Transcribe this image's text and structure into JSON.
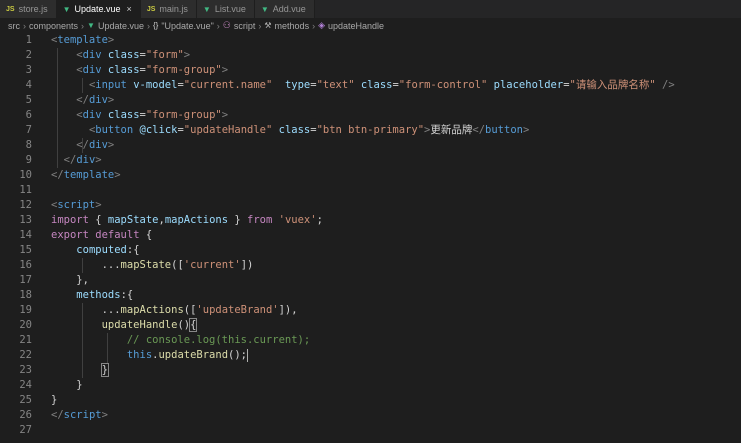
{
  "tabs": [
    {
      "label": "store.js",
      "type": "js",
      "active": false
    },
    {
      "label": "Update.vue",
      "type": "vue",
      "active": true
    },
    {
      "label": "main.js",
      "type": "js",
      "active": false
    },
    {
      "label": "List.vue",
      "type": "vue",
      "active": false
    },
    {
      "label": "Add.vue",
      "type": "vue",
      "active": false
    }
  ],
  "breadcrumb": [
    {
      "label": "src",
      "icon": "none"
    },
    {
      "label": "components",
      "icon": "none"
    },
    {
      "label": "Update.vue",
      "icon": "vue-file-icon"
    },
    {
      "label": "\"Update.vue\"",
      "icon": "object-icon"
    },
    {
      "label": "script",
      "icon": "symbol-icon"
    },
    {
      "label": "methods",
      "icon": "wrench-icon"
    },
    {
      "label": "updateHandle",
      "icon": "method-cube-icon"
    }
  ],
  "colors": {
    "editor_bg": "#1e1e1e",
    "tab_bar_bg": "#252526",
    "tag": "#569cd6",
    "attribute": "#9cdcfe",
    "string": "#ce9178",
    "keyword": "#c586c0",
    "function": "#dcdcaa",
    "comment": "#6a9955"
  },
  "lines": [
    {
      "n": "1",
      "tokens": [
        [
          "<",
          "t-bracket"
        ],
        [
          "template",
          "t-tag"
        ],
        [
          ">",
          "t-bracket"
        ]
      ]
    },
    {
      "n": "2",
      "tokens": [
        [
          "    ",
          "t-text"
        ],
        [
          "<",
          "t-bracket"
        ],
        [
          "div",
          "t-tag"
        ],
        [
          " ",
          "t-text"
        ],
        [
          "class",
          "t-attr"
        ],
        [
          "=",
          "t-text"
        ],
        [
          "\"form\"",
          "t-str"
        ],
        [
          ">",
          "t-bracket"
        ]
      ]
    },
    {
      "n": "3",
      "tokens": [
        [
          "    ",
          "t-text"
        ],
        [
          "<",
          "t-bracket"
        ],
        [
          "div",
          "t-tag"
        ],
        [
          " ",
          "t-text"
        ],
        [
          "class",
          "t-attr"
        ],
        [
          "=",
          "t-text"
        ],
        [
          "\"form-group\"",
          "t-str"
        ],
        [
          ">",
          "t-bracket"
        ]
      ]
    },
    {
      "n": "4",
      "tokens": [
        [
          "      ",
          "t-text"
        ],
        [
          "<",
          "t-bracket"
        ],
        [
          "input",
          "t-tag"
        ],
        [
          " ",
          "t-text"
        ],
        [
          "v-model",
          "t-attr"
        ],
        [
          "=",
          "t-text"
        ],
        [
          "\"current.name\"",
          "t-str"
        ],
        [
          "  ",
          "t-text"
        ],
        [
          "type",
          "t-attr"
        ],
        [
          "=",
          "t-text"
        ],
        [
          "\"text\"",
          "t-str"
        ],
        [
          " ",
          "t-text"
        ],
        [
          "class",
          "t-attr"
        ],
        [
          "=",
          "t-text"
        ],
        [
          "\"form-control\"",
          "t-str"
        ],
        [
          " ",
          "t-text"
        ],
        [
          "placeholder",
          "t-attr"
        ],
        [
          "=",
          "t-text"
        ],
        [
          "\"请输入品牌名称\"",
          "t-str"
        ],
        [
          " ",
          "t-text"
        ],
        [
          "/>",
          "t-bracket"
        ]
      ]
    },
    {
      "n": "5",
      "tokens": [
        [
          "    ",
          "t-text"
        ],
        [
          "</",
          "t-bracket"
        ],
        [
          "div",
          "t-tag"
        ],
        [
          ">",
          "t-bracket"
        ]
      ]
    },
    {
      "n": "6",
      "tokens": [
        [
          "    ",
          "t-text"
        ],
        [
          "<",
          "t-bracket"
        ],
        [
          "div",
          "t-tag"
        ],
        [
          " ",
          "t-text"
        ],
        [
          "class",
          "t-attr"
        ],
        [
          "=",
          "t-text"
        ],
        [
          "\"form-group\"",
          "t-str"
        ],
        [
          ">",
          "t-bracket"
        ]
      ]
    },
    {
      "n": "7",
      "tokens": [
        [
          "      ",
          "t-text"
        ],
        [
          "<",
          "t-bracket"
        ],
        [
          "button",
          "t-tag"
        ],
        [
          " ",
          "t-text"
        ],
        [
          "@click",
          "t-attr"
        ],
        [
          "=",
          "t-text"
        ],
        [
          "\"updateHandle\"",
          "t-str"
        ],
        [
          " ",
          "t-text"
        ],
        [
          "class",
          "t-attr"
        ],
        [
          "=",
          "t-text"
        ],
        [
          "\"btn btn-primary\"",
          "t-str"
        ],
        [
          ">",
          "t-bracket"
        ],
        [
          "更新品牌",
          "t-text"
        ],
        [
          "</",
          "t-bracket"
        ],
        [
          "button",
          "t-tag"
        ],
        [
          ">",
          "t-bracket"
        ]
      ]
    },
    {
      "n": "8",
      "tokens": [
        [
          "    ",
          "t-text"
        ],
        [
          "</",
          "t-bracket"
        ],
        [
          "div",
          "t-tag"
        ],
        [
          ">",
          "t-bracket"
        ]
      ]
    },
    {
      "n": "9",
      "tokens": [
        [
          "  ",
          "t-text"
        ],
        [
          "</",
          "t-bracket"
        ],
        [
          "div",
          "t-tag"
        ],
        [
          ">",
          "t-bracket"
        ]
      ]
    },
    {
      "n": "10",
      "tokens": [
        [
          "</",
          "t-bracket"
        ],
        [
          "template",
          "t-tag"
        ],
        [
          ">",
          "t-bracket"
        ]
      ]
    },
    {
      "n": "11",
      "tokens": []
    },
    {
      "n": "12",
      "tokens": [
        [
          "<",
          "t-bracket"
        ],
        [
          "script",
          "t-tag"
        ],
        [
          ">",
          "t-bracket"
        ]
      ]
    },
    {
      "n": "13",
      "tokens": [
        [
          "import",
          "t-kw"
        ],
        [
          " { ",
          "t-punc"
        ],
        [
          "mapState",
          "t-var"
        ],
        [
          ",",
          "t-punc"
        ],
        [
          "mapActions",
          "t-var"
        ],
        [
          " } ",
          "t-punc"
        ],
        [
          "from",
          "t-kw"
        ],
        [
          " ",
          "t-text"
        ],
        [
          "'vuex'",
          "t-str"
        ],
        [
          ";",
          "t-punc"
        ]
      ]
    },
    {
      "n": "14",
      "tokens": [
        [
          "export",
          "t-kw"
        ],
        [
          " ",
          "t-text"
        ],
        [
          "default",
          "t-kw"
        ],
        [
          " {",
          "t-punc"
        ]
      ]
    },
    {
      "n": "15",
      "tokens": [
        [
          "    ",
          "t-text"
        ],
        [
          "computed",
          "t-var"
        ],
        [
          ":{",
          "t-punc"
        ]
      ]
    },
    {
      "n": "16",
      "tokens": [
        [
          "        ",
          "t-text"
        ],
        [
          "...",
          "t-punc"
        ],
        [
          "mapState",
          "t-fn"
        ],
        [
          "([",
          "t-punc"
        ],
        [
          "'current'",
          "t-str"
        ],
        [
          "])",
          "t-punc"
        ]
      ]
    },
    {
      "n": "17",
      "tokens": [
        [
          "    ",
          "t-text"
        ],
        [
          "},",
          "t-punc"
        ]
      ]
    },
    {
      "n": "18",
      "tokens": [
        [
          "    ",
          "t-text"
        ],
        [
          "methods",
          "t-var"
        ],
        [
          ":{",
          "t-punc"
        ]
      ]
    },
    {
      "n": "19",
      "tokens": [
        [
          "        ",
          "t-text"
        ],
        [
          "...",
          "t-punc"
        ],
        [
          "mapActions",
          "t-fn"
        ],
        [
          "([",
          "t-punc"
        ],
        [
          "'updateBrand'",
          "t-str"
        ],
        [
          "]),",
          "t-punc"
        ]
      ]
    },
    {
      "n": "20",
      "tokens": [
        [
          "        ",
          "t-text"
        ],
        [
          "updateHandle",
          "t-fn"
        ],
        [
          "()",
          "t-punc"
        ],
        [
          "{",
          "t-punc bhl"
        ]
      ]
    },
    {
      "n": "21",
      "tokens": [
        [
          "            ",
          "t-text"
        ],
        [
          "// console.log(this.current);",
          "t-com"
        ]
      ]
    },
    {
      "n": "22",
      "tokens": [
        [
          "            ",
          "t-text"
        ],
        [
          "this",
          "t-kw2"
        ],
        [
          ".",
          "t-punc"
        ],
        [
          "updateBrand",
          "t-fn"
        ],
        [
          "();",
          "t-punc"
        ],
        [
          "|",
          "cursor"
        ]
      ]
    },
    {
      "n": "23",
      "tokens": [
        [
          "        ",
          "t-text"
        ],
        [
          "}",
          "t-punc bhl"
        ]
      ]
    },
    {
      "n": "24",
      "tokens": [
        [
          "    ",
          "t-text"
        ],
        [
          "}",
          "t-punc"
        ]
      ]
    },
    {
      "n": "25",
      "tokens": [
        [
          "}",
          "t-punc"
        ]
      ]
    },
    {
      "n": "26",
      "tokens": [
        [
          "</",
          "t-bracket"
        ],
        [
          "script",
          "t-tag"
        ],
        [
          ">",
          "t-bracket"
        ]
      ]
    },
    {
      "n": "27",
      "tokens": []
    }
  ]
}
